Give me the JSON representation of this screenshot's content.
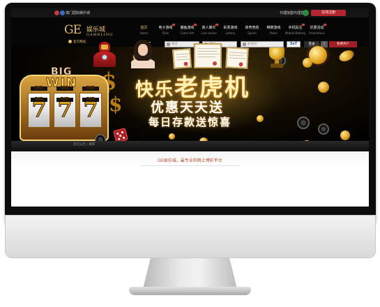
{
  "topbar": {
    "notice": "澳门国际娱乐城",
    "agent_register": "代理加盟",
    "agent_login": "代理登录",
    "register": "在线注册"
  },
  "brand": {
    "logo_ge": "GE",
    "logo_cn": "娱乐城",
    "logo_en": "GAMBLING",
    "official": "官方网站"
  },
  "nav": {
    "items": [
      {
        "cn": "首页",
        "en": "Home"
      },
      {
        "cn": "电子游戏",
        "en": "Slots"
      },
      {
        "cn": "捕鱼游戏",
        "en": "Catch fish"
      },
      {
        "cn": "真人娱乐",
        "en": "Live casino"
      },
      {
        "cn": "彩票游戏",
        "en": "Lottery"
      },
      {
        "cn": "体育竞技",
        "en": "Sports"
      },
      {
        "cn": "棋牌游戏",
        "en": "Poker"
      },
      {
        "cn": "手机投注",
        "en": "Mobile Betting"
      },
      {
        "cn": "优惠活动",
        "en": "Promotions"
      }
    ]
  },
  "login": {
    "username_placeholder": "账号",
    "password_placeholder": "密码",
    "captcha_placeholder": "验证码",
    "captcha_code": "5eT",
    "login_button": "登录",
    "forgot": "?",
    "free_register": "免费开户"
  },
  "banner": {
    "big": "BIG",
    "win": "WIN",
    "reel_symbol": "7",
    "bar": "BAR",
    "title_part1": "快乐",
    "title_part2": "老虎机",
    "title_line2": "优惠天天送",
    "title_line3": "每日存款送惊喜"
  },
  "breadcrumb": "首页公告 / 最新",
  "content": {
    "slogan": "GE娱乐城，最专业的网上博彩平台"
  },
  "colors": {
    "gold": "#e3c16e",
    "register_red": "#b3262d",
    "dark": "#050505"
  }
}
